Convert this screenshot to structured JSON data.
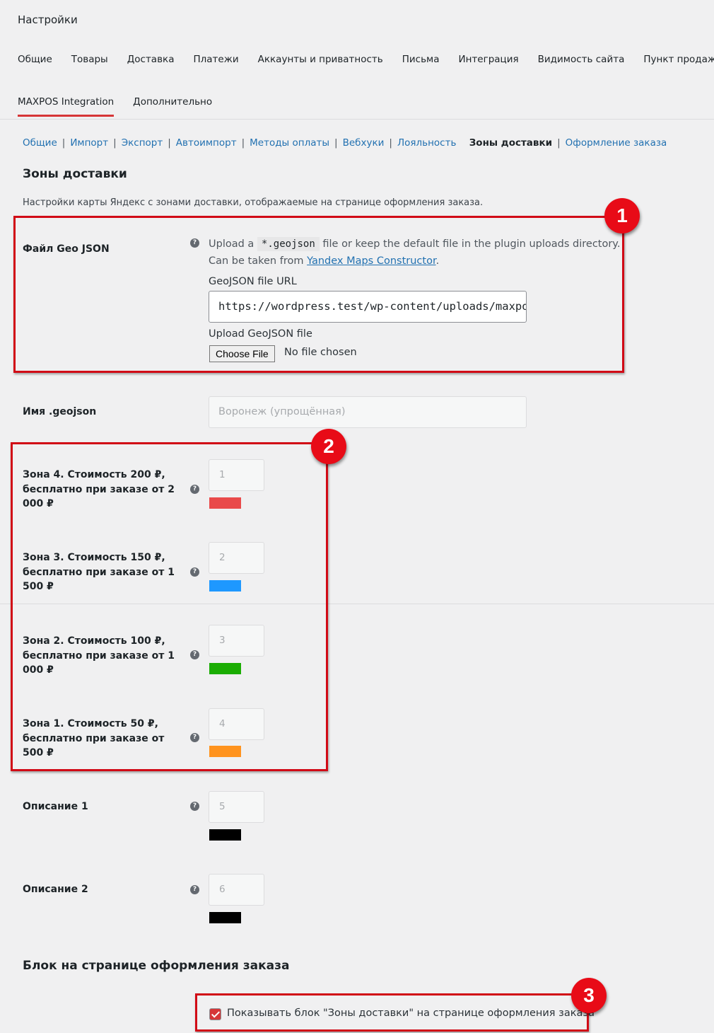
{
  "page_title": "Настройки",
  "main_tabs": [
    "Общие",
    "Товары",
    "Доставка",
    "Платежи",
    "Аккаунты и приватность",
    "Письма",
    "Интеграция",
    "Видимость сайта",
    "Пункт продажи"
  ],
  "sub_tabs": [
    {
      "label": "MAXPOS Integration",
      "active": true
    },
    {
      "label": "Дополнительно",
      "active": false
    }
  ],
  "subsub": [
    "Общие",
    "Импорт",
    "Экспорт",
    "Автоимпорт",
    "Методы оплаты",
    "Вебхуки",
    "Лояльность",
    "Зоны доставки",
    "Оформление заказа"
  ],
  "subsub_current": "Зоны доставки",
  "section1": {
    "title": "Зоны доставки",
    "description": "Настройки карты Яндекс с зонами доставки, отображаемые на странице оформления заказа."
  },
  "geojson": {
    "label": "Файл Geo JSON",
    "desc_prefix": "Upload a",
    "desc_code": "*.geojson",
    "desc_suffix": "file or keep the default file in the plugin uploads directory.",
    "desc_line2_prefix": "Can be taken from",
    "desc_link": "Yandex Maps Constructor",
    "desc_line2_suffix": ".",
    "url_label": "GeoJSON file URL",
    "url_value": "https://wordpress.test/wp-content/uploads/maxpos/zones.geojson",
    "upload_label": "Upload GeoJSON file",
    "choose_file": "Choose File",
    "no_file": "No file chosen"
  },
  "name_field": {
    "label": "Имя .geojson",
    "placeholder": "Воронеж (упрощённая)"
  },
  "zones": [
    {
      "label": "Зона 4. Стоимость 200 ₽, бесплатно при заказе от 2 000 ₽",
      "value": "1",
      "color": "#e94a4a"
    },
    {
      "label": "Зона 3. Стоимость 150 ₽, бесплатно при заказе от 1 500 ₽",
      "value": "2",
      "color": "#1e98ff"
    },
    {
      "label": "Зона 2. Стоимость 100 ₽, бесплатно при заказе от 1 000 ₽",
      "value": "3",
      "color": "#1bad03"
    },
    {
      "label": "Зона 1. Стоимость 50 ₽, бесплатно при заказе от 500 ₽",
      "value": "4",
      "color": "#ff931e"
    },
    {
      "label": "Описание 1",
      "value": "5",
      "color": "#000000"
    },
    {
      "label": "Описание 2",
      "value": "6",
      "color": "#000000"
    }
  ],
  "section2": {
    "title": "Блок на странице оформления заказа"
  },
  "show_block": {
    "label": "Показывать блок \"Зоны доставки\" на странице оформления заказа",
    "checked": true
  },
  "annotations": [
    "1",
    "2",
    "3"
  ],
  "help_glyph": "?",
  "colors": {
    "accent": "#d63638",
    "link": "#2271b1",
    "annotation": "#e80b17"
  }
}
